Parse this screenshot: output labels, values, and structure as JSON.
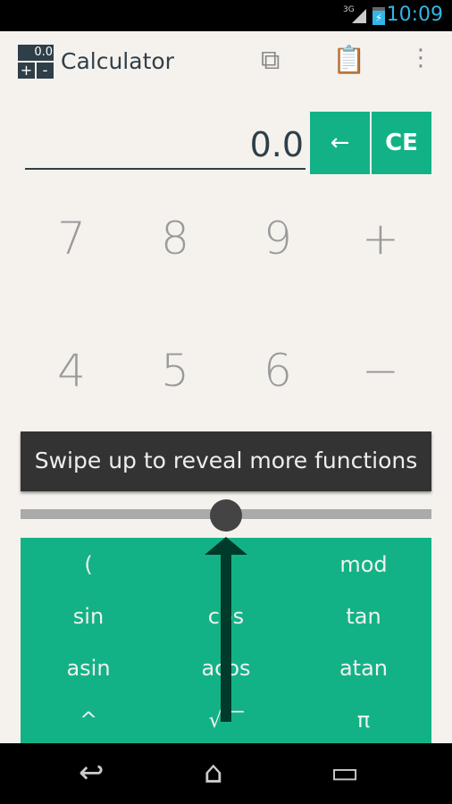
{
  "status": {
    "network": "3G",
    "time": "10:09",
    "battery_icon": "battery-charging-icon",
    "signal_icon": "signal-icon"
  },
  "actionbar": {
    "logo_display": "0.0",
    "logo_plus": "+",
    "logo_minus": "-",
    "title": "Calculator",
    "icons": [
      "copy-icon",
      "paste-icon",
      "overflow-menu-icon"
    ]
  },
  "display": {
    "value": "0.0"
  },
  "buttons": {
    "backspace": "←",
    "clear": "CE"
  },
  "digits": [
    [
      "7",
      "8",
      "9",
      "+"
    ],
    [
      "4",
      "5",
      "6",
      "−"
    ]
  ],
  "tooltip": "Swipe up to reveal more functions",
  "functions": [
    [
      "(",
      ")",
      "mod"
    ],
    [
      "sin",
      "cos",
      "tan"
    ],
    [
      "asin",
      "acos",
      "atan"
    ],
    [
      "^",
      "√‾‾",
      "π"
    ]
  ],
  "colors": {
    "accent": "#13b286",
    "text": "#2f3f48",
    "clock": "#33b5e5"
  }
}
